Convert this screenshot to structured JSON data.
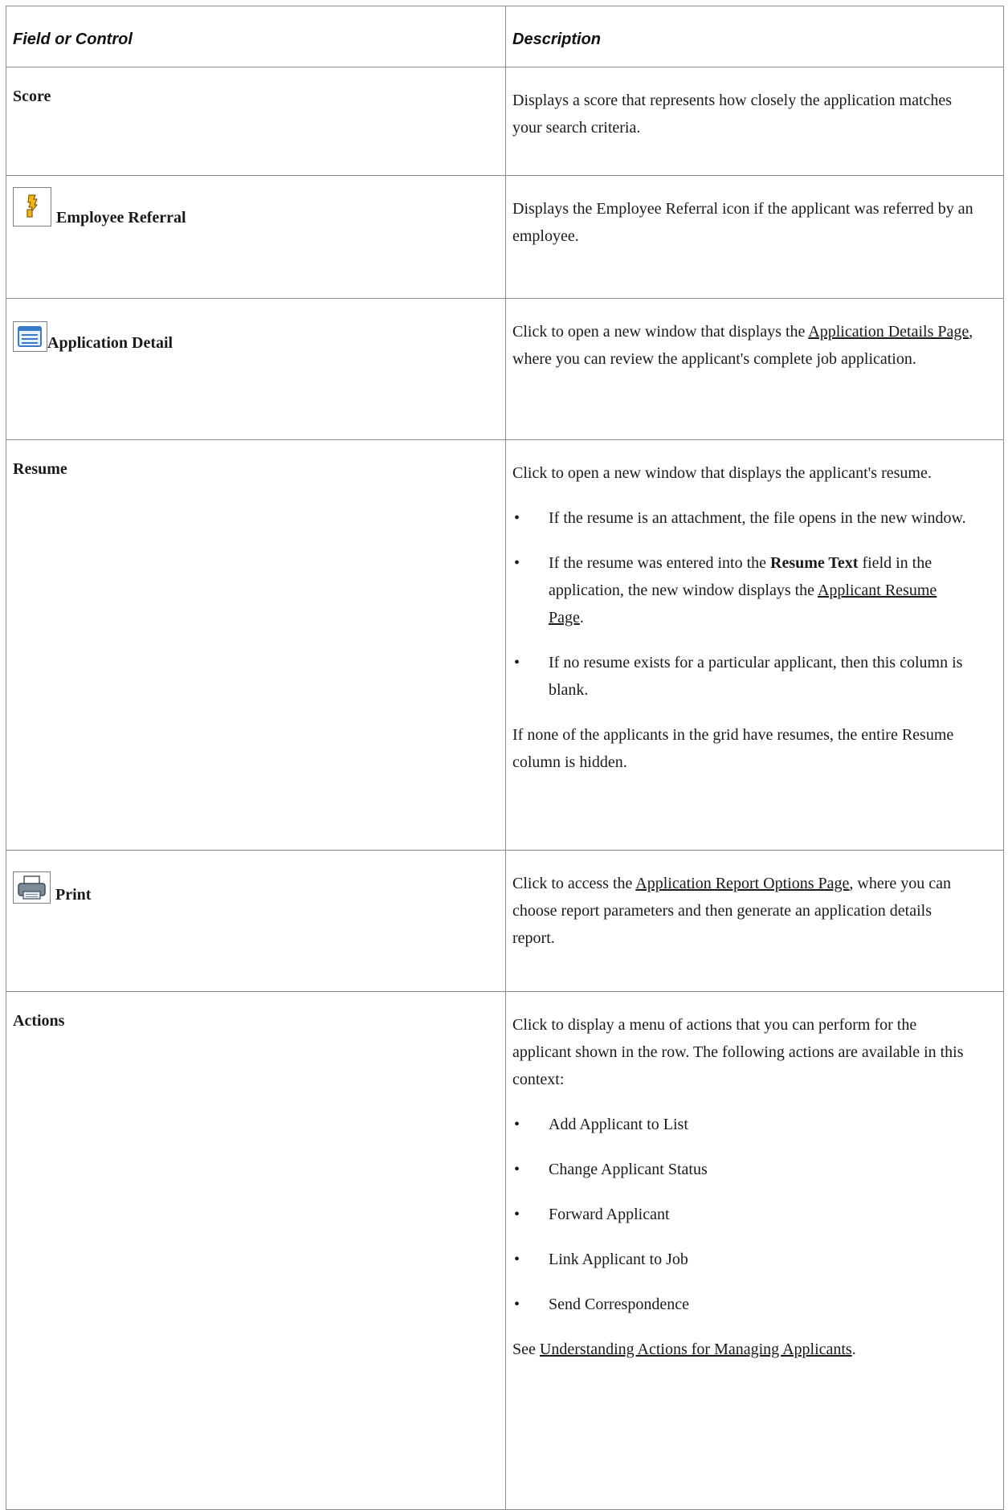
{
  "table": {
    "header": {
      "col1": "Field or Control",
      "col2": "Description"
    },
    "rows": [
      {
        "field": "Score",
        "desc": "Displays a score that represents how closely the application matches your search criteria."
      },
      {
        "field": "Employee Referral",
        "icon": "employee-referral-icon",
        "desc": "Displays the Employee Referral icon if the applicant was referred by an employee."
      },
      {
        "field": "Application Detail",
        "icon": "application-detail-icon",
        "desc_pre": "Click to open a new window that displays the ",
        "desc_link": "Application Details Page",
        "desc_post": ", where you can review the applicant's complete job application."
      },
      {
        "field": "Resume",
        "desc_intro": "Click to open a new window that displays the applicant's resume.",
        "bullets": {
          "b1": "If the resume is an attachment, the file opens in the new window.",
          "b2_pre": "If the resume was entered into the ",
          "b2_bold": "Resume Text",
          "b2_mid": " field in the application, the new window displays the ",
          "b2_link": "Applicant Resume Page",
          "b2_post": ".",
          "b3": "If no resume exists for a particular applicant, then this column is blank."
        },
        "desc_outro": "If none of the applicants in the grid have resumes, the entire Resume column is hidden."
      },
      {
        "field": "Print",
        "icon": "print-icon",
        "desc_pre": "Click to access the ",
        "desc_link": "Application Report Options Page",
        "desc_post": ", where you can choose report parameters and then generate an application details report."
      },
      {
        "field": "Actions",
        "desc_intro": "Click to display a menu of actions that you can perform for the applicant shown in the row. The following actions are available in this context:",
        "bullets": [
          "Add Applicant to List",
          "Change Applicant Status",
          "Forward Applicant",
          "Link Applicant to Job",
          "Send Correspondence"
        ],
        "see_pre": "See ",
        "see_link": "Understanding Actions for Managing Applicants",
        "see_post": "."
      }
    ]
  }
}
